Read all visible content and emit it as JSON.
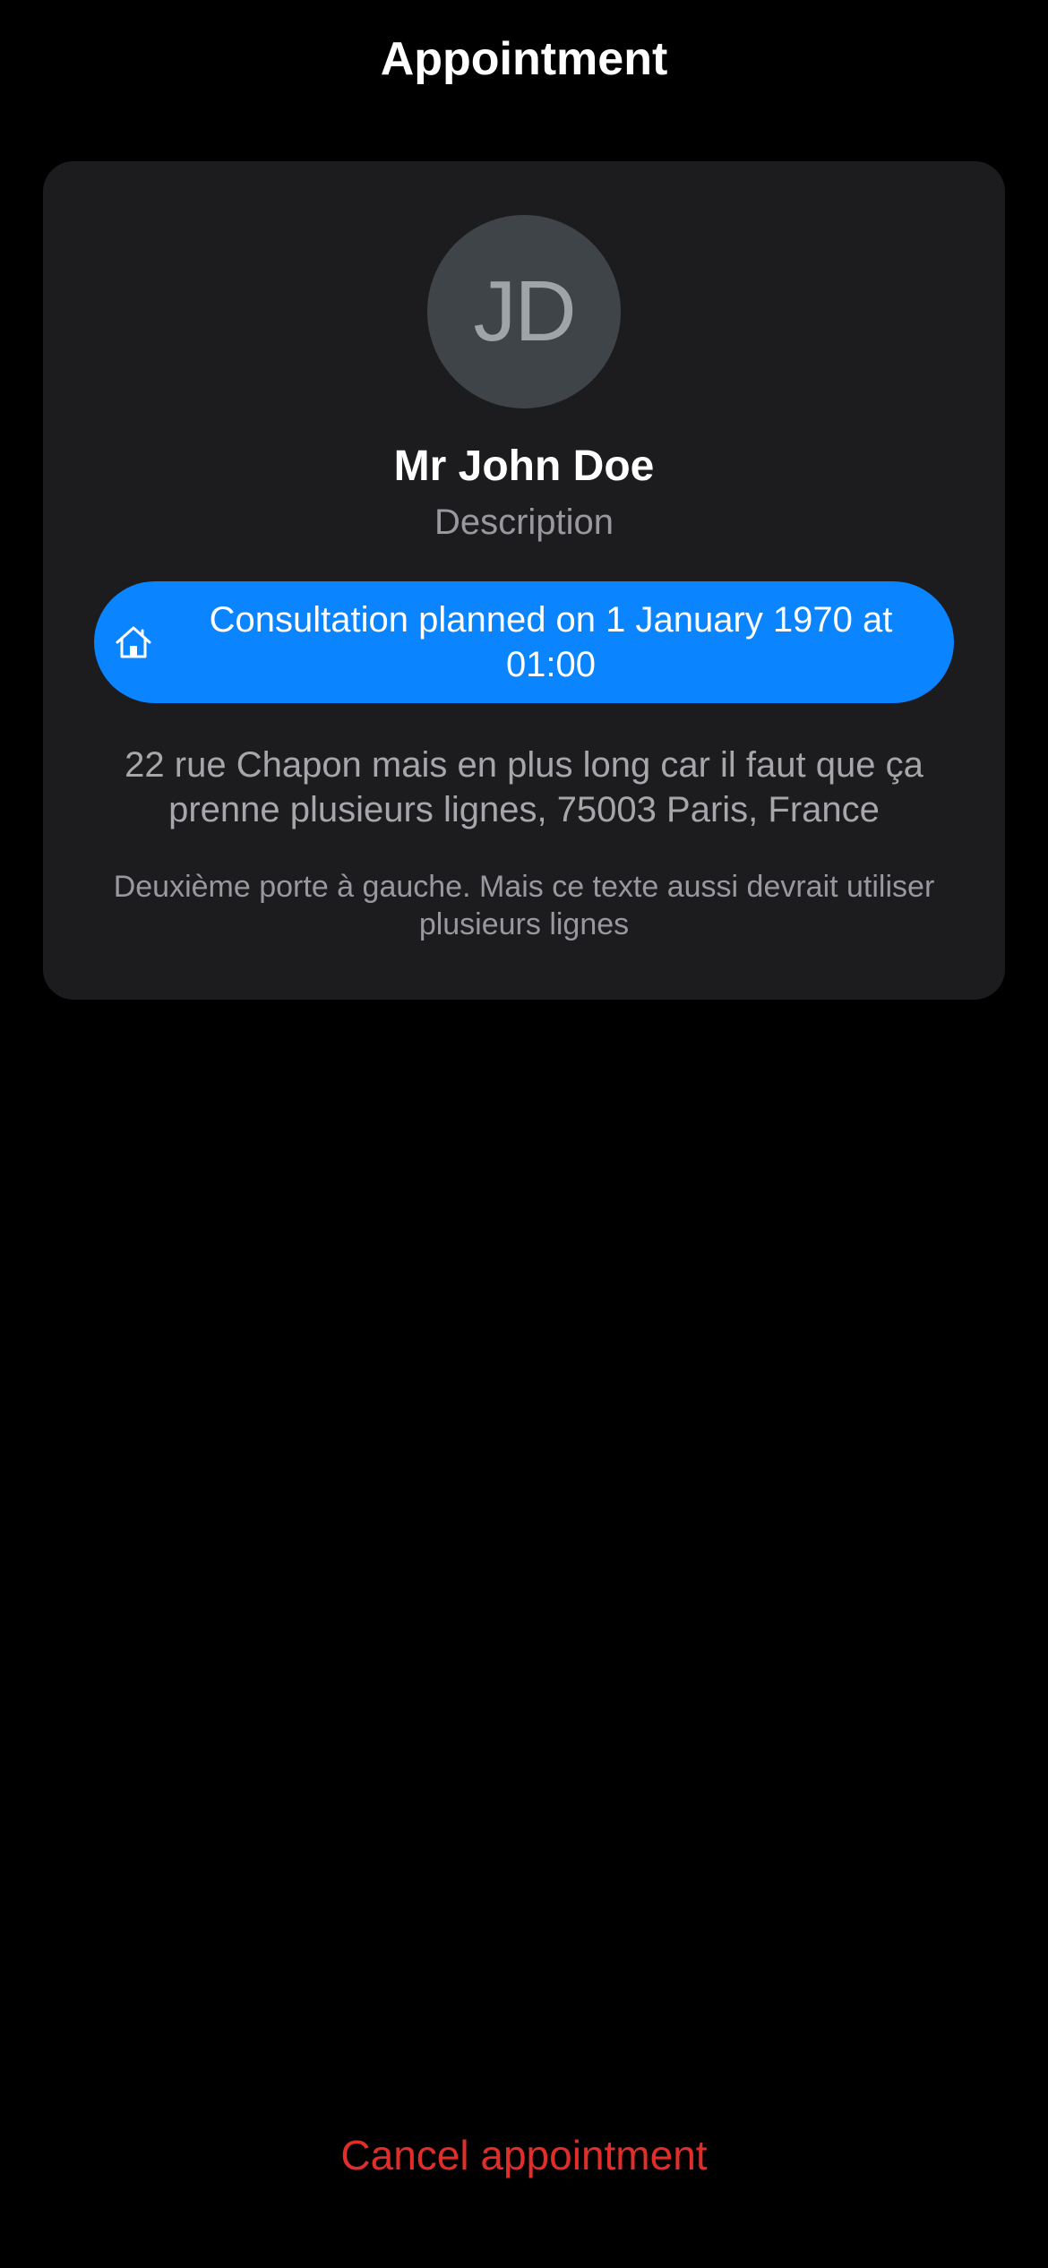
{
  "header": {
    "title": "Appointment"
  },
  "card": {
    "avatar_initials": "JD",
    "name": "Mr John Doe",
    "description": "Description",
    "consultation": {
      "icon": "home-icon",
      "label": "Consultation planned on 1 January 1970 at 01:00",
      "color": "#0a84ff"
    },
    "address": "22 rue Chapon mais en plus long car il faut que ça prenne plusieurs lignes, 75003 Paris, France",
    "note": "Deuxième porte à gauche. Mais ce texte aussi devrait utiliser plusieurs lignes"
  },
  "actions": {
    "cancel_label": "Cancel appointment",
    "cancel_color": "#e02e2a"
  }
}
